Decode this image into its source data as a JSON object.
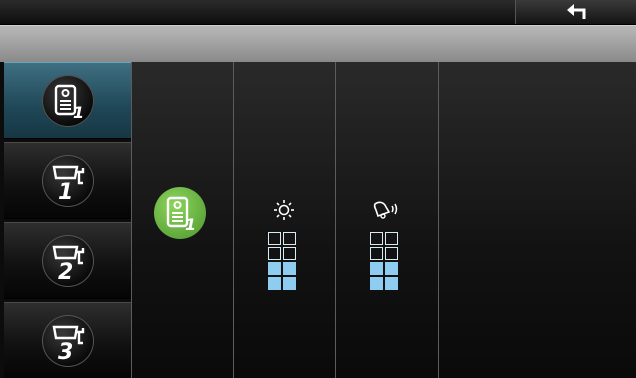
{
  "colors": {
    "accent_active": "#1f4757",
    "selected_green": "#6fbf45",
    "level_on": "#8fcdf0",
    "level_off": "#d9ecf6"
  },
  "topbar": {
    "back_icon": "back-arrow-icon"
  },
  "sidebar": {
    "items": [
      {
        "icon": "door-station-icon",
        "number": "1",
        "active": true
      },
      {
        "icon": "camera-icon",
        "number": "1",
        "active": false
      },
      {
        "icon": "camera-icon",
        "number": "2",
        "active": false
      },
      {
        "icon": "camera-icon",
        "number": "3",
        "active": false
      }
    ]
  },
  "settings": {
    "selected_device": {
      "icon": "door-station-icon",
      "number": "1"
    },
    "brightness": {
      "icon": "sun-icon",
      "level": 2,
      "max": 4
    },
    "volume": {
      "icon": "bell-sound-icon",
      "level": 2,
      "max": 4
    }
  }
}
